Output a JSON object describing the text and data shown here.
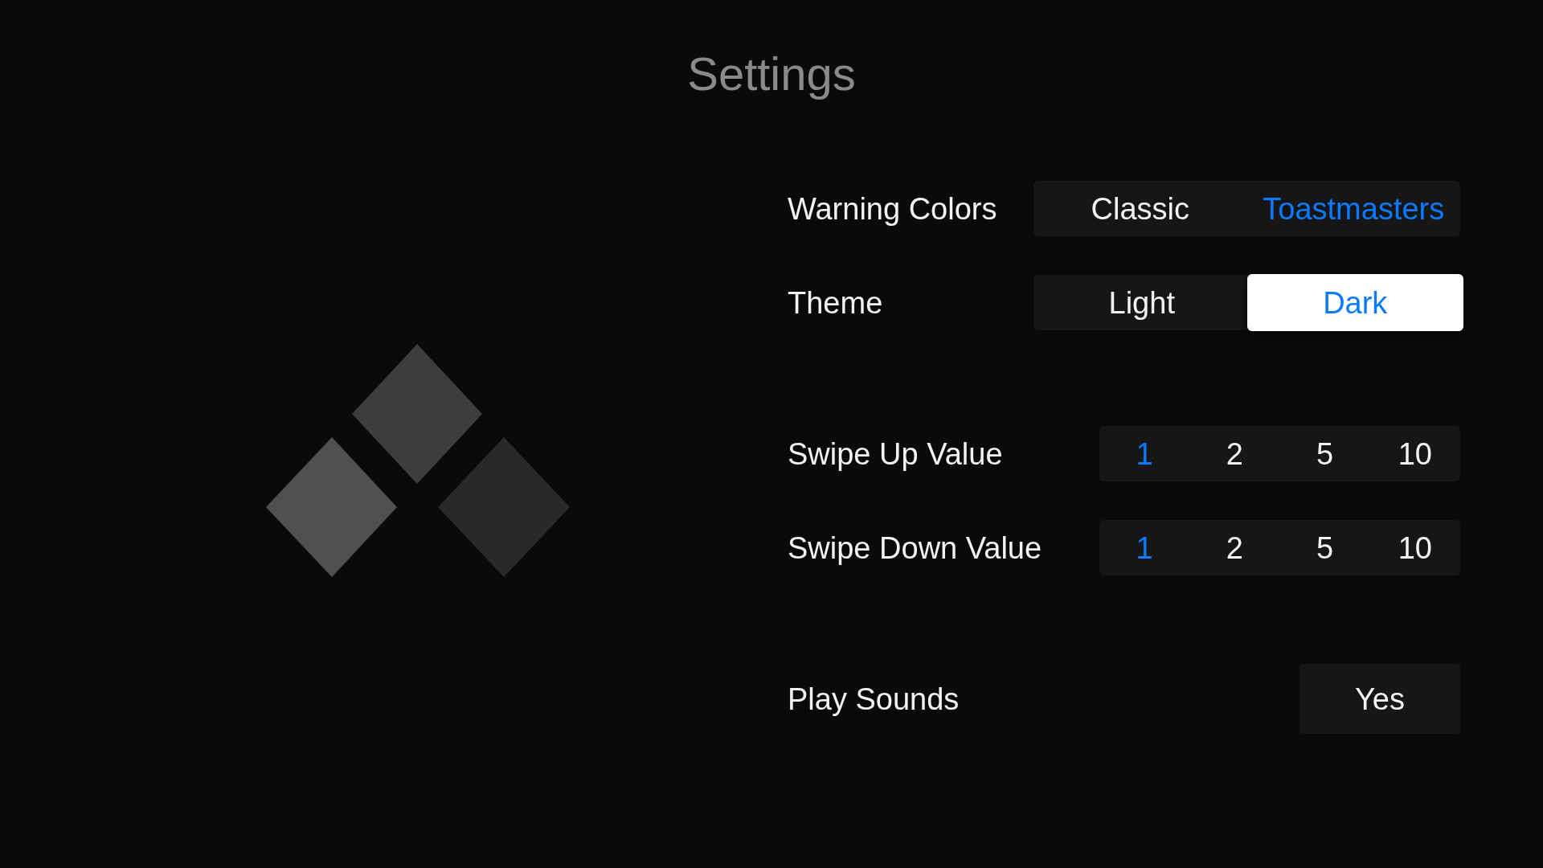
{
  "title": "Settings",
  "sections": [
    {
      "rows": [
        {
          "kind": "choice",
          "label": "Warning Colors",
          "options": [
            {
              "label": "Classic",
              "selected": false,
              "focused": false
            },
            {
              "label": "Toastmasters",
              "selected": true,
              "focused": false
            }
          ]
        },
        {
          "kind": "choice",
          "label": "Theme",
          "options": [
            {
              "label": "Light",
              "selected": false,
              "focused": false
            },
            {
              "label": "Dark",
              "selected": true,
              "focused": true
            }
          ]
        }
      ]
    },
    {
      "rows": [
        {
          "kind": "number",
          "label": "Swipe Up Value",
          "options": [
            {
              "label": "1",
              "selected": true,
              "focused": false
            },
            {
              "label": "2",
              "selected": false,
              "focused": false
            },
            {
              "label": "5",
              "selected": false,
              "focused": false
            },
            {
              "label": "10",
              "selected": false,
              "focused": false
            }
          ]
        },
        {
          "kind": "number",
          "label": "Swipe Down Value",
          "options": [
            {
              "label": "1",
              "selected": true,
              "focused": false
            },
            {
              "label": "2",
              "selected": false,
              "focused": false
            },
            {
              "label": "5",
              "selected": false,
              "focused": false
            },
            {
              "label": "10",
              "selected": false,
              "focused": false
            }
          ]
        }
      ]
    },
    {
      "rows": [
        {
          "kind": "button",
          "label": "Play Sounds",
          "value": "Yes"
        }
      ]
    }
  ]
}
